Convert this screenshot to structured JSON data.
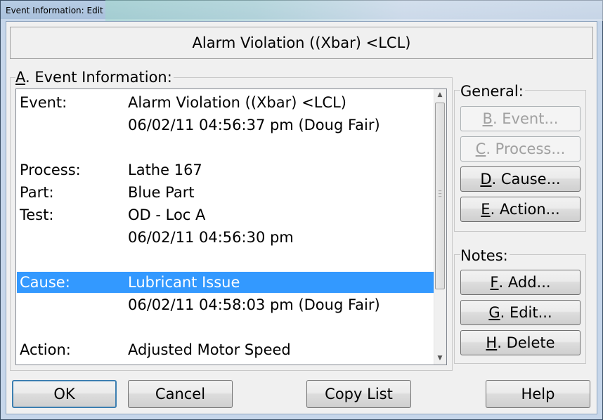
{
  "window": {
    "title": "Event Information: Edit"
  },
  "header": {
    "title": "Alarm Violation ((Xbar) <LCL)"
  },
  "event_section": {
    "label_mnemonic": "A",
    "label_rest": ". Event Information:",
    "rows": [
      {
        "key": "Event:",
        "value": "Alarm Violation ((Xbar) <LCL)",
        "selected": false
      },
      {
        "key": "",
        "value": "06/02/11 04:56:37 pm (Doug Fair)",
        "selected": false
      },
      {
        "key": "",
        "value": "",
        "selected": false
      },
      {
        "key": "Process:",
        "value": "Lathe 167",
        "selected": false
      },
      {
        "key": "Part:",
        "value": "Blue Part",
        "selected": false
      },
      {
        "key": "Test:",
        "value": "OD - Loc A",
        "selected": false
      },
      {
        "key": "",
        "value": "06/02/11 04:56:30 pm",
        "selected": false
      },
      {
        "key": "",
        "value": "",
        "selected": false
      },
      {
        "key": "Cause:",
        "value": "Lubricant Issue",
        "selected": true
      },
      {
        "key": "",
        "value": "06/02/11 04:58:03 pm (Doug Fair)",
        "selected": false
      },
      {
        "key": "",
        "value": "",
        "selected": false
      },
      {
        "key": "Action:",
        "value": "Adjusted Motor Speed",
        "selected": false
      }
    ]
  },
  "general": {
    "label": "General:",
    "buttons": [
      {
        "mnemonic": "B",
        "rest": ". Event...",
        "enabled": false
      },
      {
        "mnemonic": "C",
        "rest": ". Process...",
        "enabled": false
      },
      {
        "mnemonic": "D",
        "rest": ". Cause...",
        "enabled": true
      },
      {
        "mnemonic": "E",
        "rest": ". Action...",
        "enabled": true
      }
    ]
  },
  "notes": {
    "label": "Notes:",
    "buttons": [
      {
        "mnemonic": "F",
        "rest": ". Add...",
        "enabled": true
      },
      {
        "mnemonic": "G",
        "rest": ". Edit...",
        "enabled": true
      },
      {
        "mnemonic": "H",
        "rest": ". Delete",
        "enabled": true
      }
    ]
  },
  "footer": {
    "ok": "OK",
    "cancel": "Cancel",
    "copy_list": "Copy List",
    "help": "Help"
  },
  "colors": {
    "selection": "#3399ff",
    "disabled_text": "#a0a0a0"
  }
}
